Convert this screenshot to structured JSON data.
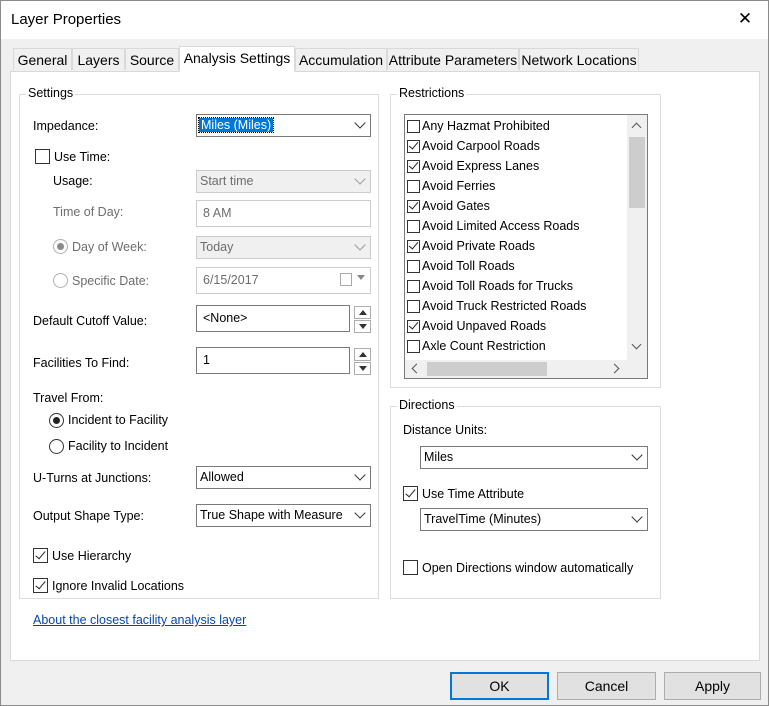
{
  "window": {
    "title": "Layer Properties",
    "close_glyph": "✕"
  },
  "tabs": [
    "General",
    "Layers",
    "Source",
    "Analysis Settings",
    "Accumulation",
    "Attribute Parameters",
    "Network Locations"
  ],
  "settings": {
    "group_title": "Settings",
    "impedance": {
      "label": "Impedance:",
      "value": "Miles (Miles)"
    },
    "use_time": {
      "label": "Use Time:",
      "checked": false
    },
    "usage": {
      "label": "Usage:",
      "value": "Start time"
    },
    "time_of_day": {
      "label": "Time of Day:",
      "value": "8 AM"
    },
    "day_of_week": {
      "label": "Day of Week:",
      "value": "Today"
    },
    "specific_date": {
      "label": "Specific Date:",
      "value": "6/15/2017"
    },
    "default_cutoff": {
      "label": "Default Cutoff Value:",
      "value": "<None>"
    },
    "facilities_to_find": {
      "label": "Facilities To Find:",
      "value": "1"
    },
    "travel_from": {
      "label": "Travel From:",
      "options": [
        "Incident to Facility",
        "Facility to Incident"
      ],
      "selected": 0
    },
    "u_turns": {
      "label": "U-Turns at Junctions:",
      "value": "Allowed"
    },
    "output_shape": {
      "label": "Output Shape Type:",
      "value": "True Shape with Measure"
    },
    "use_hierarchy": {
      "label": "Use Hierarchy",
      "checked": true
    },
    "ignore_invalid": {
      "label": "Ignore Invalid Locations",
      "checked": true
    }
  },
  "restrictions": {
    "group_title": "Restrictions",
    "items": [
      {
        "label": "Any Hazmat Prohibited",
        "checked": false
      },
      {
        "label": "Avoid Carpool Roads",
        "checked": true
      },
      {
        "label": "Avoid Express Lanes",
        "checked": true
      },
      {
        "label": "Avoid Ferries",
        "checked": false
      },
      {
        "label": "Avoid Gates",
        "checked": true
      },
      {
        "label": "Avoid Limited Access Roads",
        "checked": false
      },
      {
        "label": "Avoid Private Roads",
        "checked": true
      },
      {
        "label": "Avoid Toll Roads",
        "checked": false
      },
      {
        "label": "Avoid Toll Roads for Trucks",
        "checked": false
      },
      {
        "label": "Avoid Truck Restricted Roads",
        "checked": false
      },
      {
        "label": "Avoid Unpaved Roads",
        "checked": true
      },
      {
        "label": "Axle Count Restriction",
        "checked": false
      }
    ]
  },
  "directions": {
    "group_title": "Directions",
    "distance_units": {
      "label": "Distance Units:",
      "value": "Miles"
    },
    "use_time_attribute": {
      "label": "Use Time Attribute",
      "checked": true
    },
    "time_attribute": {
      "value": "TravelTime (Minutes)"
    },
    "open_window": {
      "label": "Open Directions window automatically",
      "checked": false
    }
  },
  "link": "About the closest facility analysis layer",
  "buttons": {
    "ok": "OK",
    "cancel": "Cancel",
    "apply": "Apply"
  }
}
